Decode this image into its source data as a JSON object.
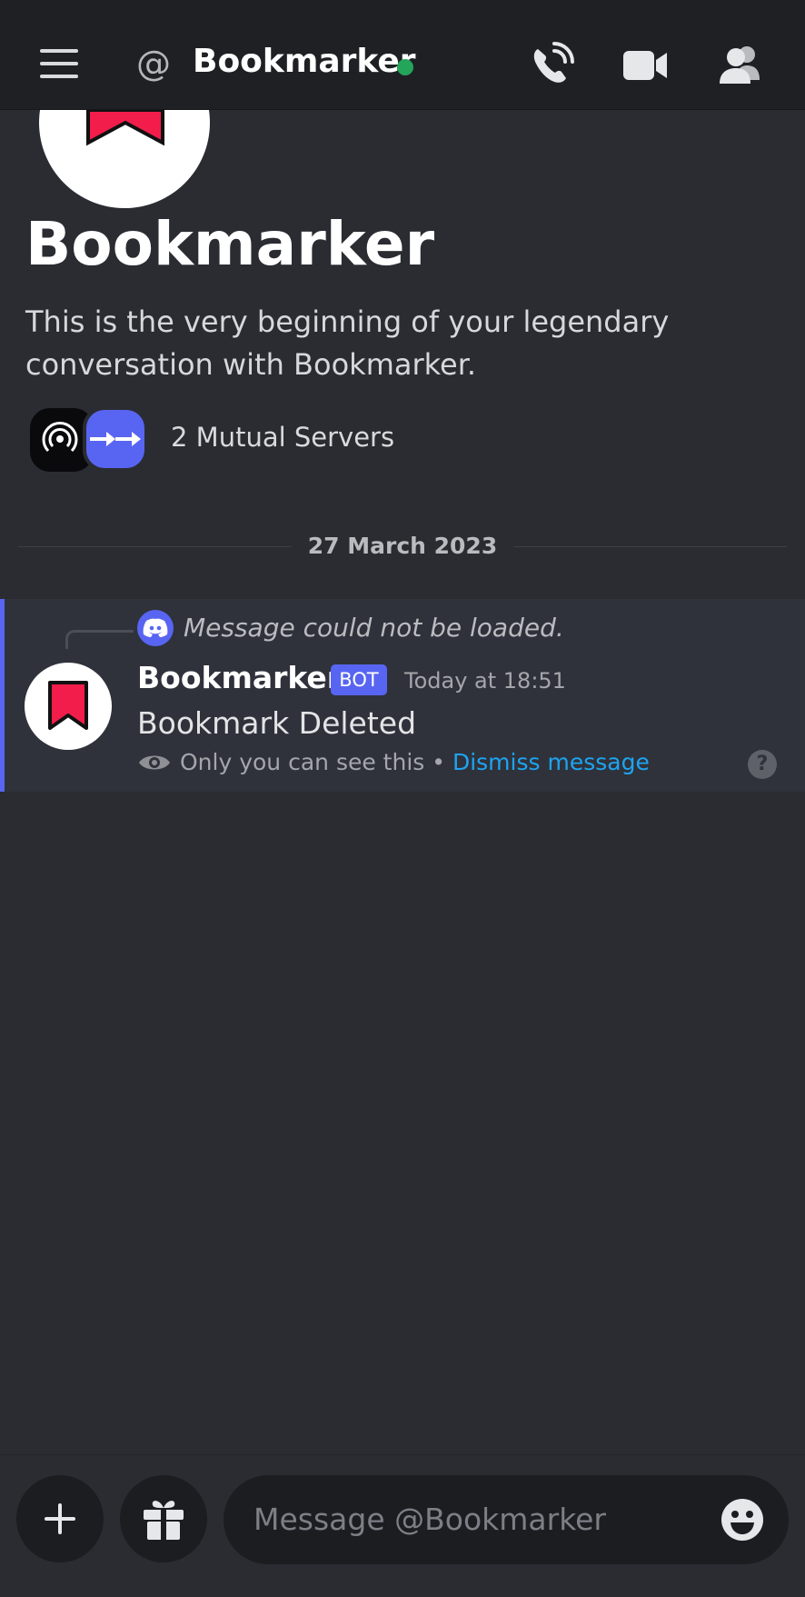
{
  "header": {
    "at_symbol": "@",
    "title": "Bookmarker",
    "status_color": "#23a55a",
    "icons": [
      "menu-icon",
      "at-icon",
      "phone-call-icon",
      "video-camera-icon",
      "members-icon"
    ]
  },
  "profile": {
    "name": "Bookmarker",
    "intro": "This is the very beginning of your legendary conversation with Bookmarker.",
    "mutual_servers": "2 Mutual Servers"
  },
  "divider": {
    "date": "27 March 2023"
  },
  "message": {
    "reply_text": "Message could not be loaded.",
    "author": "Bookmarker",
    "bot_tag": "BOT",
    "timestamp": "Today at 18:51",
    "body": "Bookmark Deleted",
    "ephemeral_note": "Only you can see this",
    "separator": " • ",
    "dismiss_label": "Dismiss message",
    "help": "?"
  },
  "composer": {
    "placeholder": "Message @Bookmarker"
  },
  "colors": {
    "accent": "#5865f2",
    "link": "#1ea4f0",
    "bookmark_red": "#f21d4b"
  }
}
